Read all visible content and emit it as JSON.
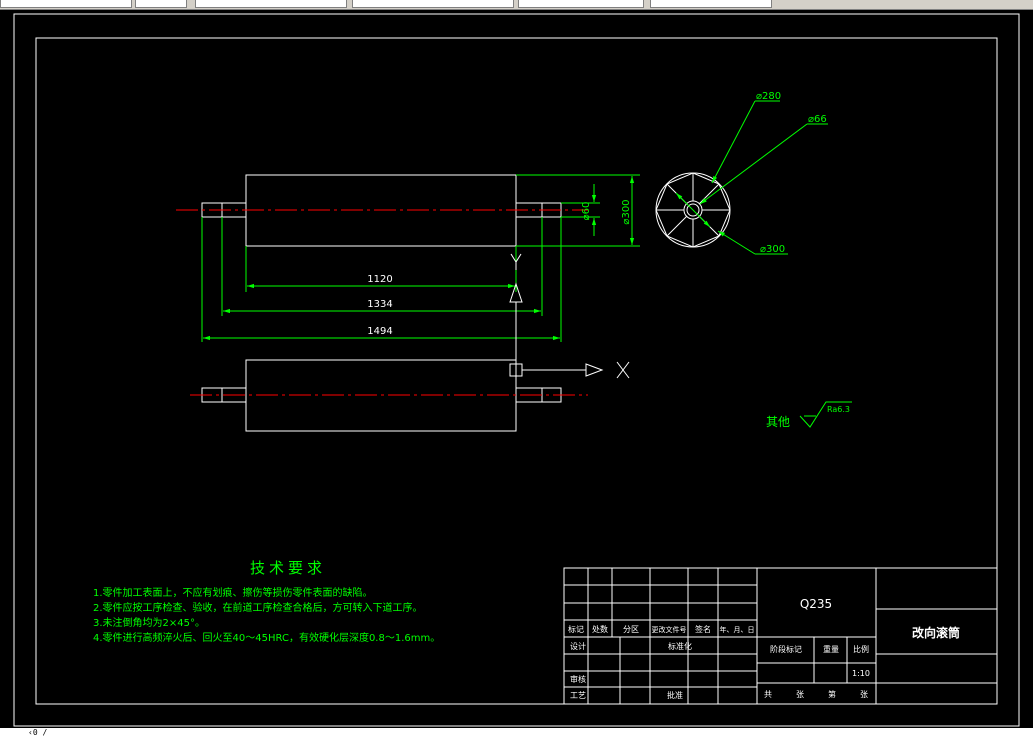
{
  "drawing": {
    "dimensions": {
      "dia_280": "⌀280",
      "dia_66": "⌀66",
      "dia_300_end": "⌀300",
      "dia_300_side": "⌀300",
      "dia_60": "⌀60",
      "len_1120": "1120",
      "len_1334": "1334",
      "len_1494": "1494"
    },
    "axes": {
      "y_label": "Y",
      "x_label": "X"
    },
    "roughness": {
      "prefix": "其他",
      "value": "Ra6.3"
    }
  },
  "tech_requirements": {
    "title": "技术要求",
    "items": [
      "1.零件加工表面上，不应有划痕、擦伤等损伤零件表面的缺陷。",
      "2.零件应按工序检查、验收，在前道工序检查合格后，方可转入下道工序。",
      "3.未注倒角均为2×45°。",
      "4.零件进行高频淬火后、回火至40～45HRC，有效硬化层深度0.8～1.6mm。"
    ]
  },
  "title_block": {
    "material": "Q235",
    "part_name": "改向滚筒",
    "header_row": [
      "标记",
      "处数",
      "分区",
      "更改文件号",
      "签名",
      "年、月、日"
    ],
    "design": "设计",
    "standardization": "标准化",
    "review": "审核",
    "process": "工艺",
    "approve": "批准",
    "stage_mark": "阶段标记",
    "weight": "重量",
    "scale_label": "比例",
    "scale_value": "1:10",
    "sheets": [
      "共",
      "张",
      "第",
      "张"
    ]
  },
  "status": {
    "fragment": "‹0 /"
  },
  "colors": {
    "background": "#000000",
    "lines": "#ffffff",
    "dims": "#00ff00",
    "center": "#ff0000"
  }
}
